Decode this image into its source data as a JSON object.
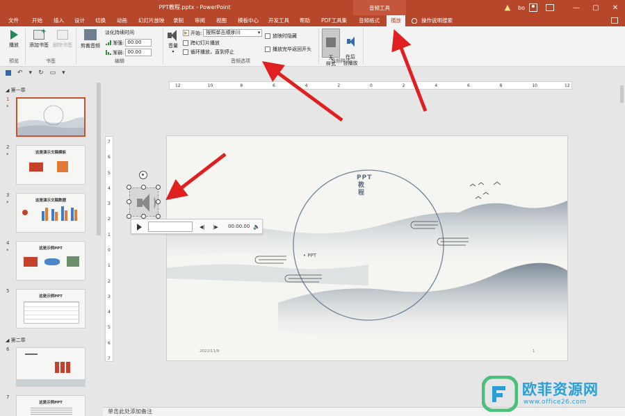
{
  "window": {
    "title": "PPT教程.pptx - PowerPoint",
    "context_tool": "音频工具",
    "user": "bo",
    "controls": {
      "minimize": "—",
      "restore": "▢",
      "close": "✕"
    }
  },
  "tabs": [
    "文件",
    "开始",
    "插入",
    "设计",
    "切换",
    "动画",
    "幻灯片放映",
    "录制",
    "审阅",
    "视图",
    "模板中心",
    "开发工具",
    "帮助",
    "PDF工具集",
    "音频格式",
    "播放"
  ],
  "active_tab": "播放",
  "tell_me": "操作说明搜索",
  "ribbon": {
    "preview": {
      "play": "播放",
      "label": "预览"
    },
    "bookmarks": {
      "add": "添加书签",
      "remove": "删除书签",
      "label": "书签"
    },
    "editing": {
      "trim": "剪裁音频",
      "fade_title": "淡化持续时间",
      "fade_in_label": "渐强:",
      "fade_in_value": "00.00",
      "fade_out_label": "渐弱:",
      "fade_out_value": "00.00",
      "label": "编辑"
    },
    "audio_options": {
      "volume": "音量",
      "start_label": "开始:",
      "start_value": "按照单击顺序(I)",
      "play_across_slides": "跨幻灯片播放",
      "loop_until_stopped": "循环播放，直到停止",
      "hide_during_show": "放映时隐藏",
      "rewind_after_playing": "播放完毕返回开头",
      "label": "音频选项"
    },
    "audio_styles": {
      "no_style": "无\n样式",
      "play_in_bg": "在后\n台播放",
      "label": "音频样式"
    }
  },
  "sections": [
    {
      "name": "第一章"
    },
    {
      "name": "第二章"
    }
  ],
  "slides": [
    {
      "number": "1",
      "star": "*",
      "title": ""
    },
    {
      "number": "2",
      "star": "*",
      "title": "这是演示文稿模板"
    },
    {
      "number": "3",
      "star": "*",
      "title": "这是演示文稿数据"
    },
    {
      "number": "4",
      "star": "*",
      "title": "这是示例PPT"
    },
    {
      "number": "5",
      "star": "",
      "title": "这是示例PPT"
    },
    {
      "number": "6",
      "star": "",
      "title": ""
    },
    {
      "number": "7",
      "star": "",
      "title": "这是示例PPT"
    }
  ],
  "ruler_h": [
    "12",
    "10",
    "8",
    "6",
    "4",
    "2",
    "0",
    "2",
    "4",
    "6",
    "8",
    "10",
    "12"
  ],
  "ruler_v": [
    "7",
    "6",
    "5",
    "4",
    "3",
    "2",
    "1",
    "0",
    "1",
    "2",
    "3",
    "4",
    "5",
    "6",
    "7"
  ],
  "slide": {
    "title_vertical": "PPT教程",
    "subtitle": "• PPT",
    "date": "2022/11/9",
    "page": "1"
  },
  "audio_player": {
    "time": "00:00.00",
    "back": "◀|",
    "forward": "|▶",
    "volume": "🔈"
  },
  "notes_placeholder": "单击此处添加备注",
  "watermark": {
    "name": "欧菲资源网",
    "url": "www.office26.com"
  },
  "colors": {
    "accent": "#b7472a",
    "arrow": "#e02020",
    "watermark": "#2a9fd6"
  }
}
